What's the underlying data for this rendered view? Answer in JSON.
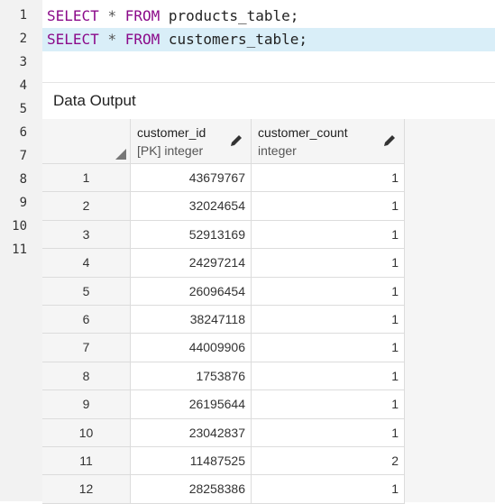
{
  "editor": {
    "line_numbers": [
      "1",
      "2",
      "3",
      "4",
      "5",
      "6",
      "7",
      "8",
      "9",
      "10",
      "11"
    ],
    "lines": [
      {
        "kw1": "SELECT",
        "star": "*",
        "kw2": "FROM",
        "table": "products_table;"
      },
      {
        "kw1": "SELECT",
        "star": "*",
        "kw2": "FROM",
        "table": "customers_table;"
      }
    ]
  },
  "output": {
    "title": "Data Output",
    "columns": [
      {
        "name": "customer_id",
        "type": "[PK] integer"
      },
      {
        "name": "customer_count",
        "type": "integer"
      }
    ],
    "rows": [
      {
        "n": "1",
        "id": "43679767",
        "count": "1"
      },
      {
        "n": "2",
        "id": "32024654",
        "count": "1"
      },
      {
        "n": "3",
        "id": "52913169",
        "count": "1"
      },
      {
        "n": "4",
        "id": "24297214",
        "count": "1"
      },
      {
        "n": "5",
        "id": "26096454",
        "count": "1"
      },
      {
        "n": "6",
        "id": "38247118",
        "count": "1"
      },
      {
        "n": "7",
        "id": "44009906",
        "count": "1"
      },
      {
        "n": "8",
        "id": "1753876",
        "count": "1"
      },
      {
        "n": "9",
        "id": "26195644",
        "count": "1"
      },
      {
        "n": "10",
        "id": "23042837",
        "count": "1"
      },
      {
        "n": "11",
        "id": "11487525",
        "count": "2"
      },
      {
        "n": "12",
        "id": "28258386",
        "count": "1"
      }
    ]
  }
}
